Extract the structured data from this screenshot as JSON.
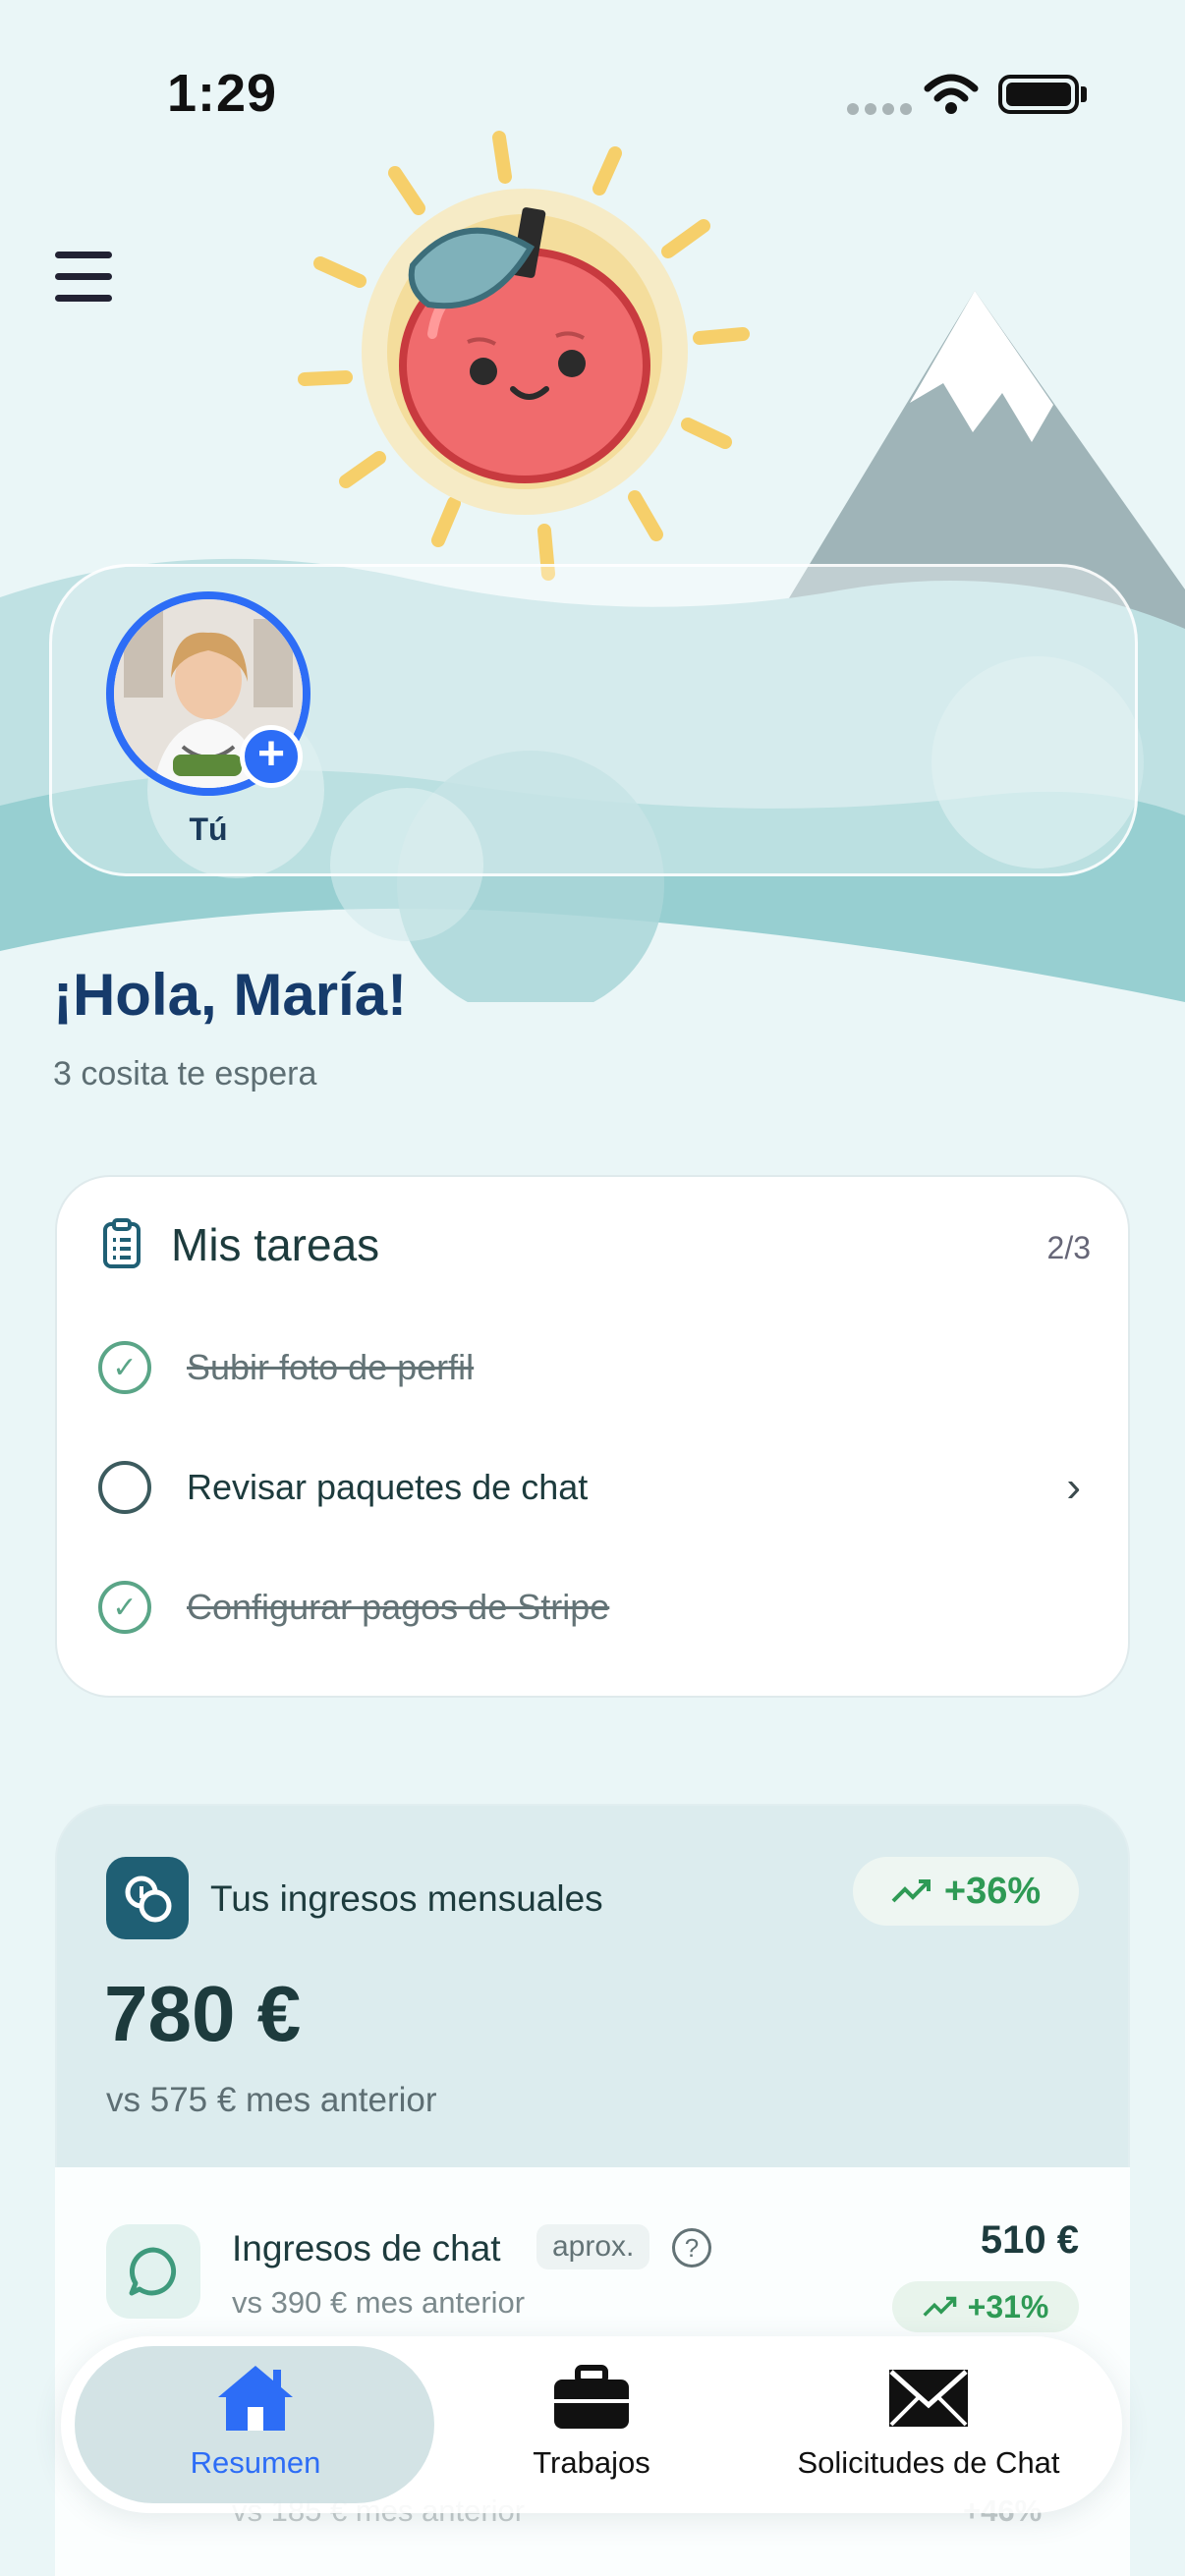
{
  "status_bar": {
    "time": "1:29"
  },
  "stories": {
    "self_label": "Tú"
  },
  "greeting": {
    "title": "¡Hola, María!",
    "subtitle": "3 cosita te espera"
  },
  "tasks": {
    "title": "Mis tareas",
    "count": "2/3",
    "items": [
      {
        "label": "Subir foto de perfil",
        "done": true
      },
      {
        "label": "Revisar paquetes de chat",
        "done": false
      },
      {
        "label": "Configurar pagos de Stripe",
        "done": true
      }
    ]
  },
  "income": {
    "title": "Tus ingresos mensuales",
    "trend": "+36%",
    "amount": "780 €",
    "comparison": "vs 575 € mes anterior",
    "rows": [
      {
        "title": "Ingresos de chat",
        "badge": "aprox.",
        "comparison": "vs 390 € mes anterior",
        "amount": "510 €",
        "trend": "+31%"
      },
      {
        "comparison": "vs 185 € mes anterior",
        "trend": "+46%"
      }
    ]
  },
  "tabbar": {
    "tabs": [
      {
        "label": "Resumen",
        "icon": "home-icon",
        "active": true
      },
      {
        "label": "Trabajos",
        "icon": "briefcase-icon",
        "active": false
      },
      {
        "label": "Solicitudes de Chat",
        "icon": "envelope-icon",
        "active": false
      }
    ]
  },
  "colors": {
    "accent": "#2d6df6",
    "positive": "#2e9a55",
    "heading": "#163b6b"
  }
}
